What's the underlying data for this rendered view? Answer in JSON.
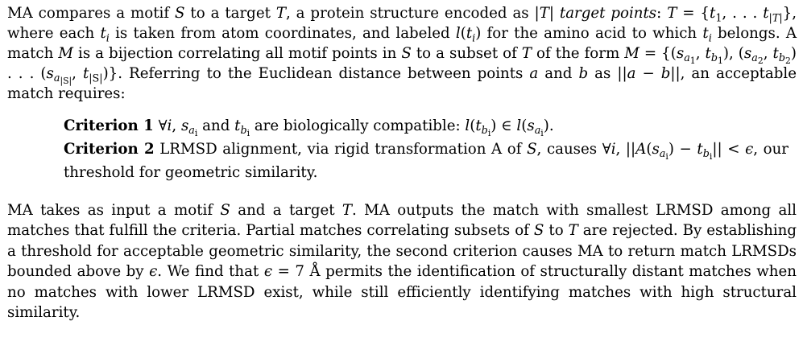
{
  "paragraph1": {
    "t1": "MA compares a motif ",
    "S1": "S",
    "t2": " to a target ",
    "T1": "T",
    "t3": ", a protein structure encoded as |",
    "T2": "T",
    "t4": "| ",
    "tp": "target points",
    "t5": ": ",
    "T3": "T",
    "t6": " = {",
    "set": "t",
    "t7": ", where each ",
    "ti": "t",
    "t8": " is taken from atom coordinates, and labeled ",
    "lt": "l",
    "t9": " for the amino acid to which ",
    "ti2": "t",
    "t10": " belongs. A match ",
    "M1": "M",
    "t11": " is a bijection correlating all motif points in ",
    "S2": "S",
    "t12": " to a subset of ",
    "T4": "T",
    "t13": " of the form ",
    "M2": "M",
    "t14": ". Referring to the Euclidean distance between points ",
    "a": "a",
    "t15": " and ",
    "b": "b",
    "t16": " as ||",
    "t17": "||, an acceptable match requires:"
  },
  "criteria": {
    "c1_label": "Criterion 1",
    "c1_text_a": " ∀",
    "c1_text_b": " and ",
    "c1_text_c": " are biologically compatible: ",
    "c2_label": "Criterion 2",
    "c2_text_a": " LRMSD alignment, via rigid transformation A of ",
    "c2_text_b": ", causes ∀",
    "c2_text_c": ", our threshold for geometric similarity."
  },
  "paragraph2": {
    "text_a": "MA takes as input a motif ",
    "text_b": " and a target ",
    "text_c": ". MA outputs the match with smallest LRMSD among all matches that fulfill the criteria. Partial matches correlating subsets of ",
    "text_d": " to ",
    "text_e": " are rejected. By establishing a threshold for acceptable geometric similarity, the second criterion causes MA to return match LRMSDs bounded above by ",
    "text_f": ". We find that ",
    "text_g": " = 7 Å permits the identification of structurally distant matches when no matches with lower LRMSD exist, while still efficiently identifying matches with high structural similarity."
  }
}
